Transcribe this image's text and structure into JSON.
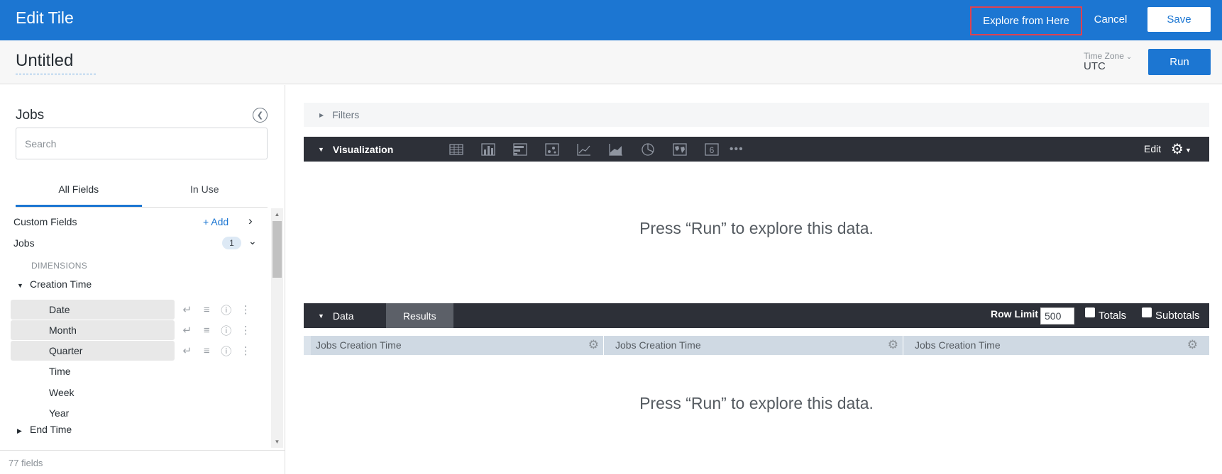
{
  "header": {
    "title": "Edit Tile",
    "explore_label": "Explore from Here",
    "cancel_label": "Cancel",
    "save_label": "Save"
  },
  "subbar": {
    "tile_name": "Untitled",
    "timezone_label": "Time Zone",
    "timezone_value": "UTC",
    "run_label": "Run"
  },
  "sidebar": {
    "title": "Jobs",
    "search_placeholder": "Search",
    "tabs": [
      {
        "label": "All Fields",
        "active": true
      },
      {
        "label": "In Use",
        "active": false
      }
    ],
    "custom_fields_label": "Custom Fields",
    "add_label": "+ Add",
    "view_label": "Jobs",
    "view_count": "1",
    "dimensions_label": "DIMENSIONS",
    "group_label": "Creation Time",
    "fields": [
      {
        "label": "Date",
        "selected": true
      },
      {
        "label": "Month",
        "selected": true
      },
      {
        "label": "Quarter",
        "selected": true
      },
      {
        "label": "Time",
        "selected": false
      },
      {
        "label": "Week",
        "selected": false
      },
      {
        "label": "Year",
        "selected": false
      }
    ],
    "next_group_label": "End Time",
    "footer": "77 fields"
  },
  "main": {
    "filters_label": "Filters",
    "viz_label": "Visualization",
    "viz_icons": [
      "table-icon",
      "column-chart-icon",
      "bar-chart-icon",
      "scatter-icon",
      "line-chart-icon",
      "area-chart-icon",
      "pie-chart-icon",
      "map-icon",
      "single-value-icon"
    ],
    "single_value_glyph": "6",
    "edit_label": "Edit",
    "empty_message": "Press “Run” to explore this data.",
    "data_label": "Data",
    "results_label": "Results",
    "row_limit_label": "Row Limit",
    "row_limit_value": "500",
    "totals_label": "Totals",
    "subtotals_label": "Subtotals",
    "columns": [
      "Jobs Creation Time",
      "Jobs Creation Time",
      "Jobs Creation Time"
    ],
    "empty_message_2": "Press “Run” to explore this data."
  }
}
